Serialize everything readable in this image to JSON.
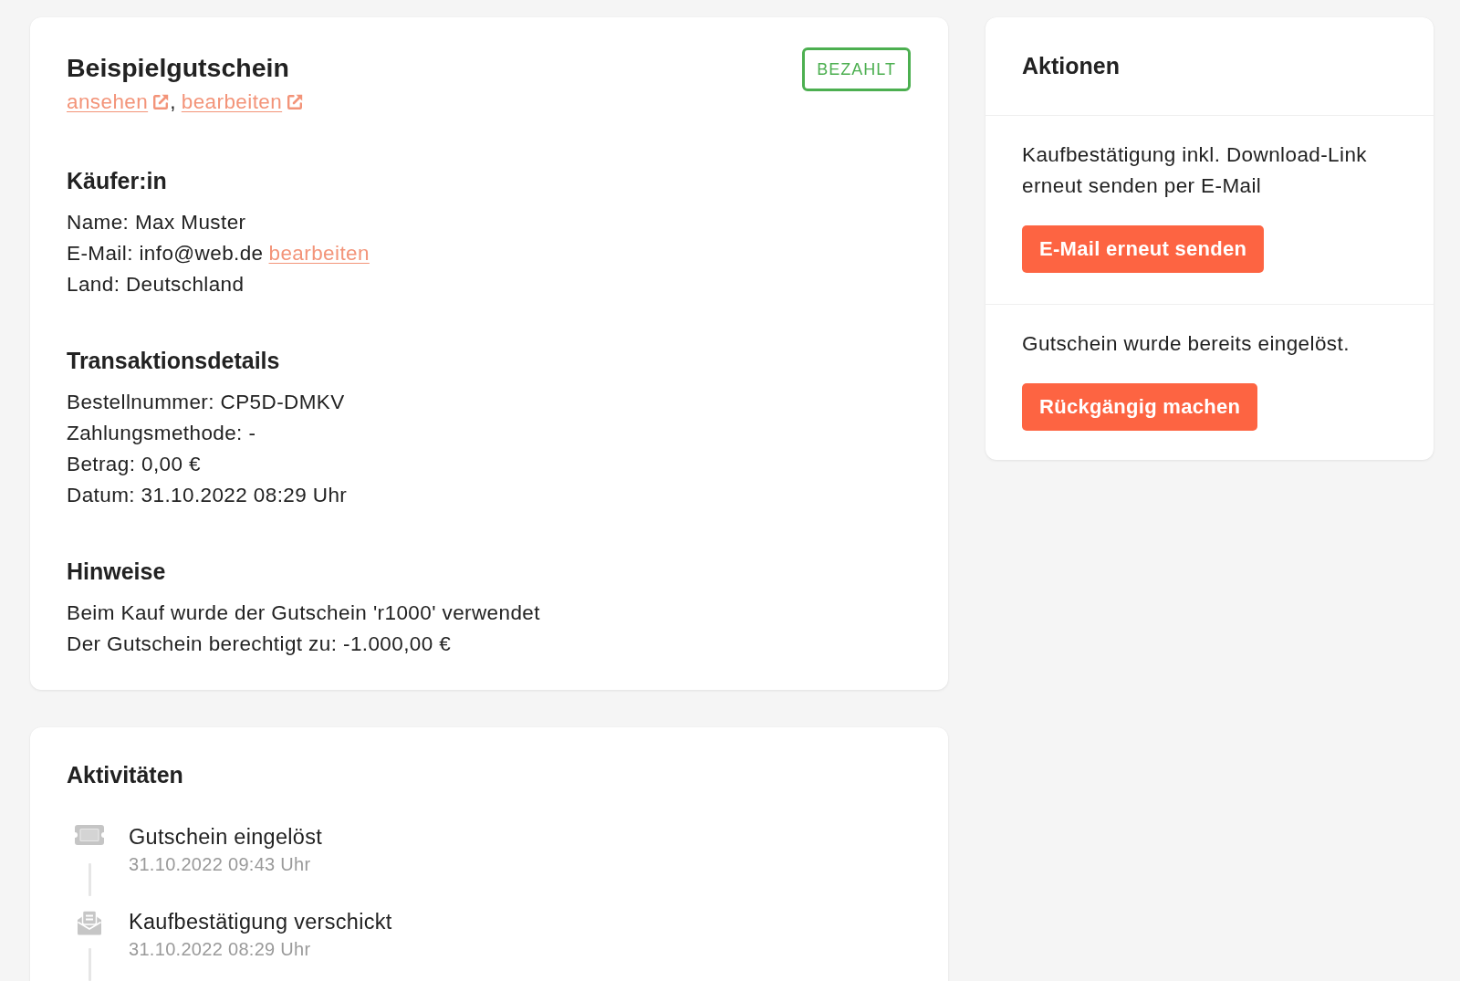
{
  "voucher_card": {
    "title": "Beispielgutschein",
    "links": [
      {
        "label": "ansehen"
      },
      {
        "label": "bearbeiten"
      }
    ],
    "link_separator": ",",
    "status_badge": "BEZAHLT",
    "sections": [
      {
        "heading": "Käufer:in",
        "lines": [
          {
            "text": "Name: Max Muster"
          },
          {
            "text": "E-Mail: info@web.de",
            "link": "bearbeiten"
          },
          {
            "text": "Land: Deutschland"
          }
        ]
      },
      {
        "heading": "Transaktionsdetails",
        "lines": [
          {
            "text": "Bestellnummer: CP5D-DMKV"
          },
          {
            "text": "Zahlungsmethode: -"
          },
          {
            "text": "Betrag: 0,00 €"
          },
          {
            "text": "Datum: 31.10.2022 08:29 Uhr"
          }
        ]
      },
      {
        "heading": "Hinweise",
        "lines": [
          {
            "text": "Beim Kauf wurde der Gutschein 'r1000' verwendet"
          },
          {
            "text": "Der Gutschein berechtigt zu: -1.000,00 €"
          }
        ]
      }
    ]
  },
  "activities_card": {
    "title": "Aktivitäten",
    "items": [
      {
        "kind": "ticket",
        "title": "Gutschein eingelöst",
        "date": "31.10.2022 09:43 Uhr"
      },
      {
        "kind": "mail",
        "title": "Kaufbestätigung verschickt",
        "date": "31.10.2022 08:29 Uhr"
      }
    ]
  },
  "actions_card": {
    "title": "Aktionen",
    "items": [
      {
        "text": "Kaufbestätigung inkl. Download-Link erneut senden per E-Mail",
        "button": "E-Mail erneut senden"
      },
      {
        "text": "Gutschein wurde bereits eingelöst.",
        "button": "Rückgängig machen"
      }
    ]
  }
}
